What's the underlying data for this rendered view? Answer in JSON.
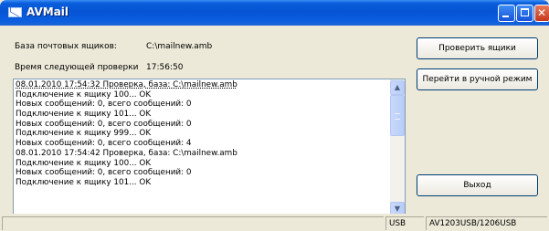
{
  "window": {
    "title": "AVMail"
  },
  "fields": {
    "mailbox_base_label": "База почтовых ящиков:",
    "mailbox_base_value": "C:\\mailnew.amb",
    "next_check_label": "Время следующей проверки",
    "next_check_value": "17:56:50"
  },
  "buttons": {
    "check": "Проверить ящики",
    "manual": "Перейти в ручной режим",
    "exit": "Выход"
  },
  "log": [
    "08.01.2010 17:54:32 Проверка, база: C:\\mailnew.amb",
    "Подключение к ящику 100... OK",
    "Новых сообщений: 0, всего сообщений: 0",
    "Подключение к ящику 101... OK",
    "Новых сообщений: 0, всего сообщений: 0",
    "Подключение к ящику 999... OK",
    "Новых сообщений: 0, всего сообщений: 4",
    "08.01.2010 17:54:42 Проверка, база: C:\\mailnew.amb",
    "Подключение к ящику 100... OK",
    "Новых сообщений: 0, всего сообщений: 0",
    "Подключение к ящику 101... OK"
  ],
  "status": {
    "pane1": "",
    "pane2": "USB",
    "pane3": "AV1203USB/1206USB"
  },
  "icons": {
    "app": "mail-envelope-icon",
    "scroll_up": "arrow-up-icon",
    "scroll_down": "arrow-down-icon"
  }
}
